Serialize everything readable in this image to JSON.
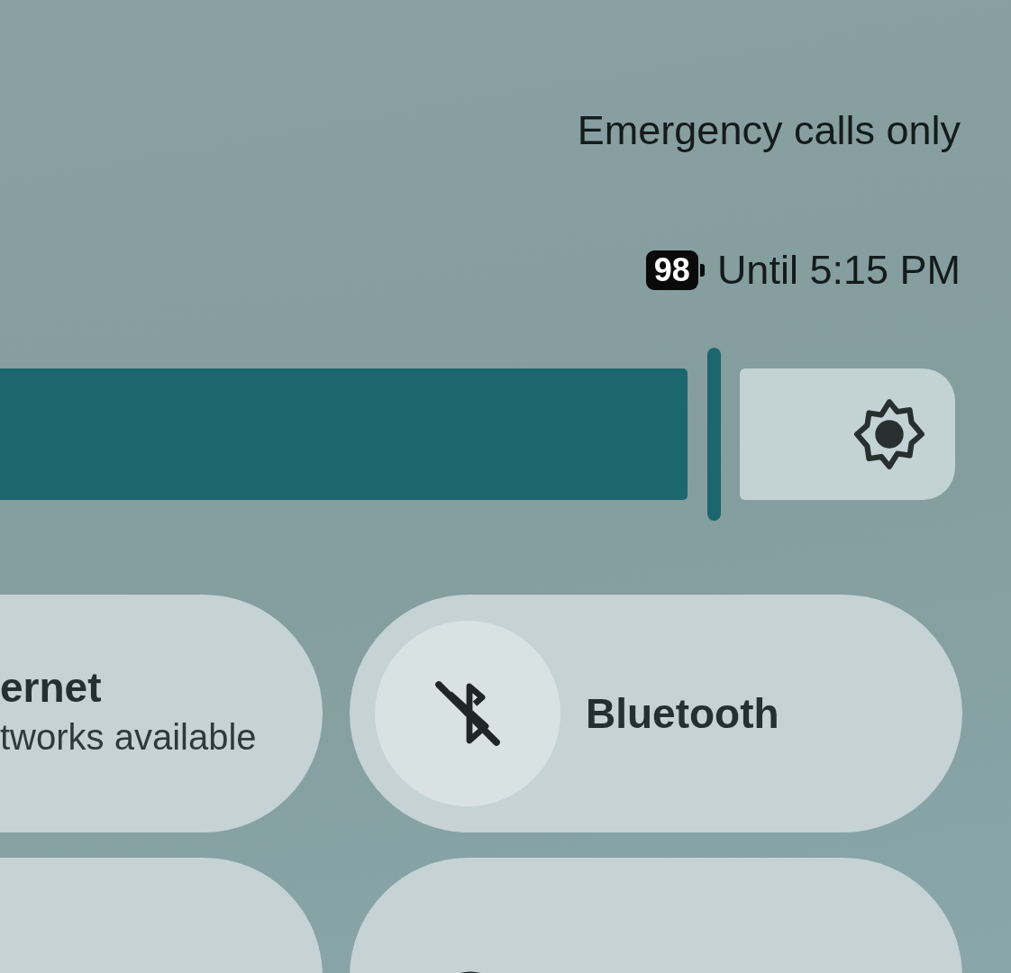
{
  "status": {
    "carrier": "Emergency calls only",
    "battery": "98",
    "battery_note": "Until 5:15 PM"
  },
  "brightness": {
    "level": 0.72
  },
  "tiles": [
    {
      "kind": "text",
      "label": "ernet",
      "subtitle": "tworks available"
    },
    {
      "kind": "icon",
      "label": "Bluetooth",
      "on": false
    },
    {
      "kind": "blank"
    },
    {
      "kind": "ring"
    }
  ]
}
